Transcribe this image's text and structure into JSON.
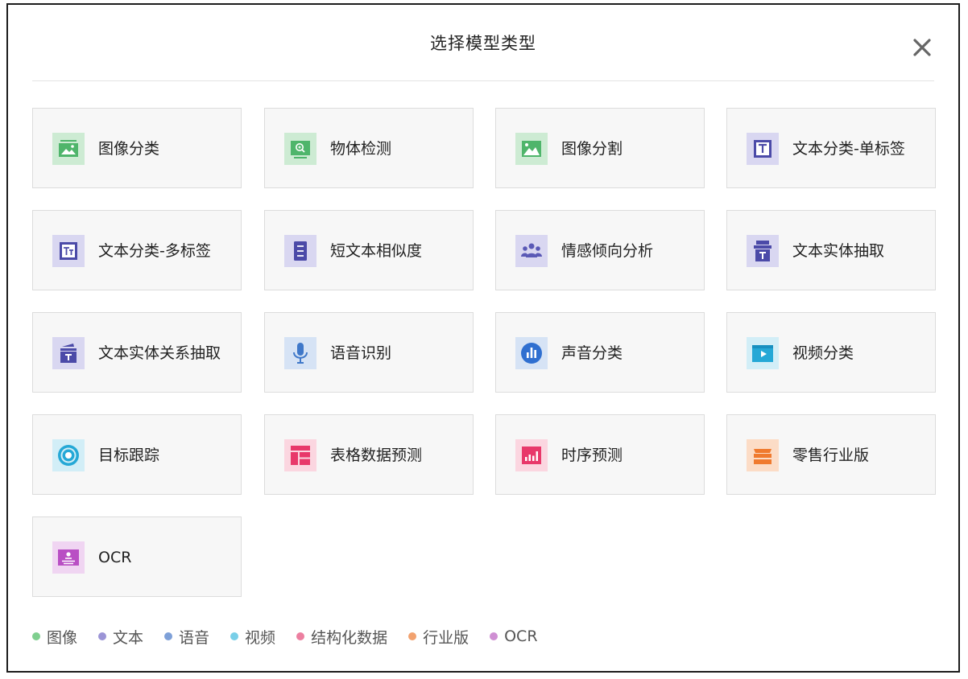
{
  "dialog": {
    "title": "选择模型类型",
    "close_icon": "close-icon"
  },
  "colors": {
    "image": "#7fcf8f",
    "text": "#9b94d6",
    "speech": "#7ea0d8",
    "video": "#79cfe8",
    "structured": "#ec7fa0",
    "industry": "#f2a26f",
    "ocr": "#cf8fd3"
  },
  "cards": [
    {
      "label": "图像分类",
      "icon": "image-classify-icon",
      "category": "image"
    },
    {
      "label": "物体检测",
      "icon": "object-detect-icon",
      "category": "image"
    },
    {
      "label": "图像分割",
      "icon": "image-segment-icon",
      "category": "image"
    },
    {
      "label": "文本分类-单标签",
      "icon": "text-single-label-icon",
      "category": "text"
    },
    {
      "label": "文本分类-多标签",
      "icon": "text-multi-label-icon",
      "category": "text"
    },
    {
      "label": "短文本相似度",
      "icon": "short-text-similarity-icon",
      "category": "text"
    },
    {
      "label": "情感倾向分析",
      "icon": "sentiment-analysis-icon",
      "category": "text"
    },
    {
      "label": "文本实体抽取",
      "icon": "text-entity-extract-icon",
      "category": "text"
    },
    {
      "label": "文本实体关系抽取",
      "icon": "text-relation-extract-icon",
      "category": "text"
    },
    {
      "label": "语音识别",
      "icon": "microphone-icon",
      "category": "speech"
    },
    {
      "label": "声音分类",
      "icon": "sound-classify-icon",
      "category": "speech"
    },
    {
      "label": "视频分类",
      "icon": "video-classify-icon",
      "category": "video"
    },
    {
      "label": "目标跟踪",
      "icon": "target-track-icon",
      "category": "video"
    },
    {
      "label": "表格数据预测",
      "icon": "table-predict-icon",
      "category": "structured"
    },
    {
      "label": "时序预测",
      "icon": "time-series-icon",
      "category": "structured"
    },
    {
      "label": "零售行业版",
      "icon": "retail-icon",
      "category": "industry"
    },
    {
      "label": "OCR",
      "icon": "ocr-icon",
      "category": "ocr"
    }
  ],
  "legend": [
    {
      "label": "图像",
      "color": "#7fcf8f"
    },
    {
      "label": "文本",
      "color": "#9b94d6"
    },
    {
      "label": "语音",
      "color": "#7ea0d8"
    },
    {
      "label": "视频",
      "color": "#79cfe8"
    },
    {
      "label": "结构化数据",
      "color": "#ec7fa0"
    },
    {
      "label": "行业版",
      "color": "#f2a26f"
    },
    {
      "label": "OCR",
      "color": "#cf8fd3"
    }
  ]
}
